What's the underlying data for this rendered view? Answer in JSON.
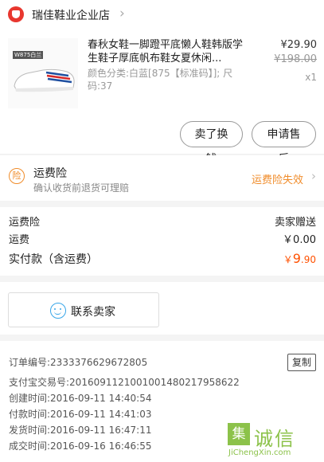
{
  "store": {
    "name": "瑞佳鞋业企业店",
    "arrow": "›"
  },
  "product": {
    "title": "春秋女鞋一脚蹬平底懒人鞋韩版学生鞋子厚底帆布鞋女夏休闲...",
    "spec": "颜色分类:白蓝[875【标准码】]; 尺码:37",
    "price": "¥29.90",
    "original_price": "¥198.00",
    "quantity": "x1",
    "thumb_tag": "W875白兰"
  },
  "actions": {
    "exchange": "卖了换钱",
    "after_sale": "申请售后"
  },
  "insurance": {
    "icon": "险",
    "title": "运费险",
    "subtitle": "确认收货前退货可理赔",
    "status": "运费险失效",
    "arrow": "›"
  },
  "fees": [
    {
      "label": "运费险",
      "value": "卖家赠送"
    },
    {
      "label": "运费",
      "value": "￥0.00"
    }
  ],
  "total": {
    "label": "实付款（含运费）",
    "currency": "￥",
    "integer": "9",
    "decimal": ".90"
  },
  "contact": {
    "label": "联系卖家"
  },
  "order": {
    "copy": "复制",
    "lines": [
      {
        "k": "订单编号: ",
        "v": "2333376629672805"
      },
      {
        "k": "支付宝交易号: ",
        "v": "2016091121001001480217958622"
      },
      {
        "k": "创建时间: ",
        "v": "2016-09-11 14:40:54"
      },
      {
        "k": "付款时间: ",
        "v": "2016-09-11 14:41:03"
      },
      {
        "k": "发货时间: ",
        "v": "2016-09-11 16:47:11"
      },
      {
        "k": "成交时间: ",
        "v": "2016-09-16 16:46:55"
      }
    ]
  },
  "watermark": {
    "badge": "集",
    "text": "诚信",
    "url": "JiChengXin.com"
  },
  "colors": {
    "accent": "#ff5000",
    "warning": "#f08c2a",
    "brand_red": "#e8372f",
    "chat_blue": "#38a6e8",
    "watermark_green": "#8cc24a"
  }
}
